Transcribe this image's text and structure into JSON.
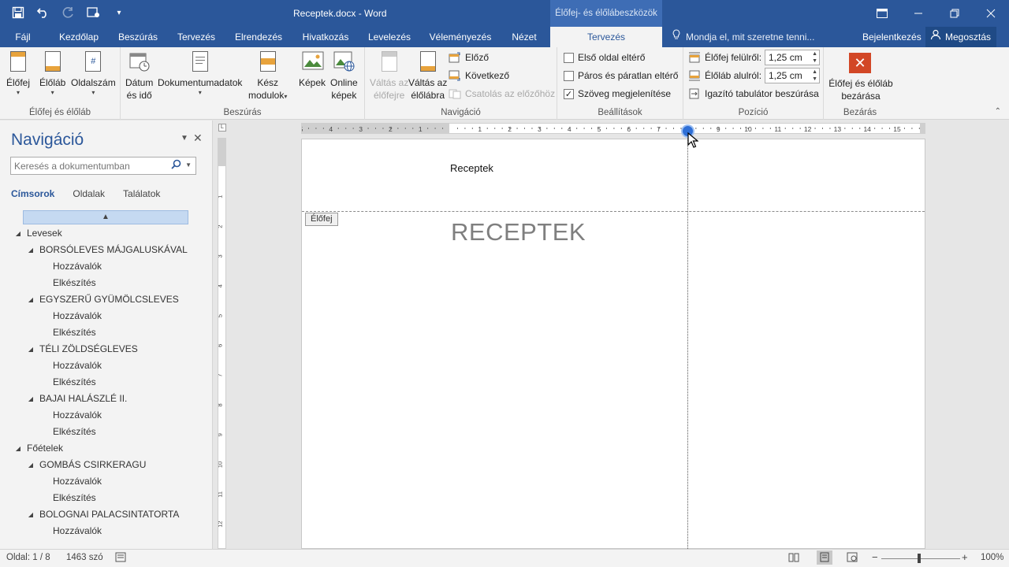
{
  "window": {
    "title": "Receptek.docx - Word",
    "context_tab_group": "Élőfej- és élőlábeszközök"
  },
  "tabs": [
    "Fájl",
    "Kezdőlap",
    "Beszúrás",
    "Tervezés",
    "Elrendezés",
    "Hivatkozás",
    "Levelezés",
    "Véleményezés",
    "Nézet",
    "Tervezés"
  ],
  "tell_me": "Mondja el, mit szeretne tenni...",
  "account": {
    "signin": "Bejelentkezés",
    "share": "Megosztás"
  },
  "ribbon": {
    "group1": {
      "label": "Élőfej és élőláb",
      "header": "Élőfej",
      "footer": "Élőláb",
      "page_number": "Oldalszám"
    },
    "group2": {
      "label": "Beszúrás",
      "date_time_1": "Dátum",
      "date_time_2": "és idő",
      "doc_info": "Dokumentumadatok",
      "quick_parts_1": "Kész",
      "quick_parts_2": "modulok",
      "pictures": "Képek",
      "online_1": "Online",
      "online_2": "képek"
    },
    "group3": {
      "label": "Navigáció",
      "goto_header_1": "Váltás az",
      "goto_header_2": "élőfejre",
      "goto_footer_1": "Váltás az",
      "goto_footer_2": "élőlábra",
      "previous": "Előző",
      "next": "Következő",
      "link_previous": "Csatolás az előzőhöz"
    },
    "group4": {
      "label": "Beállítások",
      "first_page": "Első oldal eltérő",
      "odd_even": "Páros és páratlan eltérő",
      "show_text": "Szöveg megjelenítése"
    },
    "group5": {
      "label": "Pozíció",
      "header_top": "Élőfej felülről:",
      "header_top_value": "1,25 cm",
      "footer_bottom": "Élőláb alulról:",
      "footer_bottom_value": "1,25 cm",
      "insert_tab": "Igazító tabulátor beszúrása"
    },
    "group6": {
      "label": "Bezárás",
      "close_1": "Élőfej és élőláb",
      "close_2": "bezárása"
    }
  },
  "nav": {
    "title": "Navigáció",
    "search_placeholder": "Keresés a dokumentumban",
    "tabs": [
      "Címsorok",
      "Oldalak",
      "Találatok"
    ],
    "tree": [
      {
        "level": 1,
        "label": "Levesek",
        "expand": true
      },
      {
        "level": 2,
        "label": "BORSÓLEVES MÁJGALUSKÁVAL",
        "expand": true
      },
      {
        "level": 3,
        "label": "Hozzávalók"
      },
      {
        "level": 3,
        "label": "Elkészítés"
      },
      {
        "level": 2,
        "label": "EGYSZERŰ GYÜMÖLCSLEVES",
        "expand": true
      },
      {
        "level": 3,
        "label": "Hozzávalók"
      },
      {
        "level": 3,
        "label": "Elkészítés"
      },
      {
        "level": 2,
        "label": "TÉLI ZÖLDSÉGLEVES",
        "expand": true
      },
      {
        "level": 3,
        "label": "Hozzávalók"
      },
      {
        "level": 3,
        "label": "Elkészítés"
      },
      {
        "level": 2,
        "label": "BAJAI HALÁSZLÉ II.",
        "expand": true
      },
      {
        "level": 3,
        "label": "Hozzávalók"
      },
      {
        "level": 3,
        "label": "Elkészítés"
      },
      {
        "level": 1,
        "label": "Főételek",
        "expand": true
      },
      {
        "level": 2,
        "label": "GOMBÁS CSIRKERAGU",
        "expand": true
      },
      {
        "level": 3,
        "label": "Hozzávalók"
      },
      {
        "level": 3,
        "label": "Elkészítés"
      },
      {
        "level": 2,
        "label": "BOLOGNAI PALACSINTATORTA",
        "expand": true
      },
      {
        "level": 3,
        "label": "Hozzávalók"
      }
    ]
  },
  "document": {
    "header_text": "Receptek",
    "header_tag": "Élőfej",
    "heading": "RECEPTEK"
  },
  "ruler": {
    "ticks": [
      "5",
      "4",
      "3",
      "2",
      "1",
      "1",
      "2",
      "3",
      "4",
      "5",
      "6",
      "7",
      "8",
      "9",
      "10",
      "11",
      "12",
      "13",
      "14",
      "15"
    ],
    "vticks": [
      "1",
      "2",
      "3",
      "4",
      "5",
      "6",
      "7",
      "8",
      "9",
      "10",
      "11",
      "12",
      "13"
    ]
  },
  "status": {
    "page": "Oldal: 1 / 8",
    "words": "1463 szó",
    "zoom": "100%"
  },
  "colors": {
    "accent": "#2b579a",
    "close_button": "#d24726"
  }
}
